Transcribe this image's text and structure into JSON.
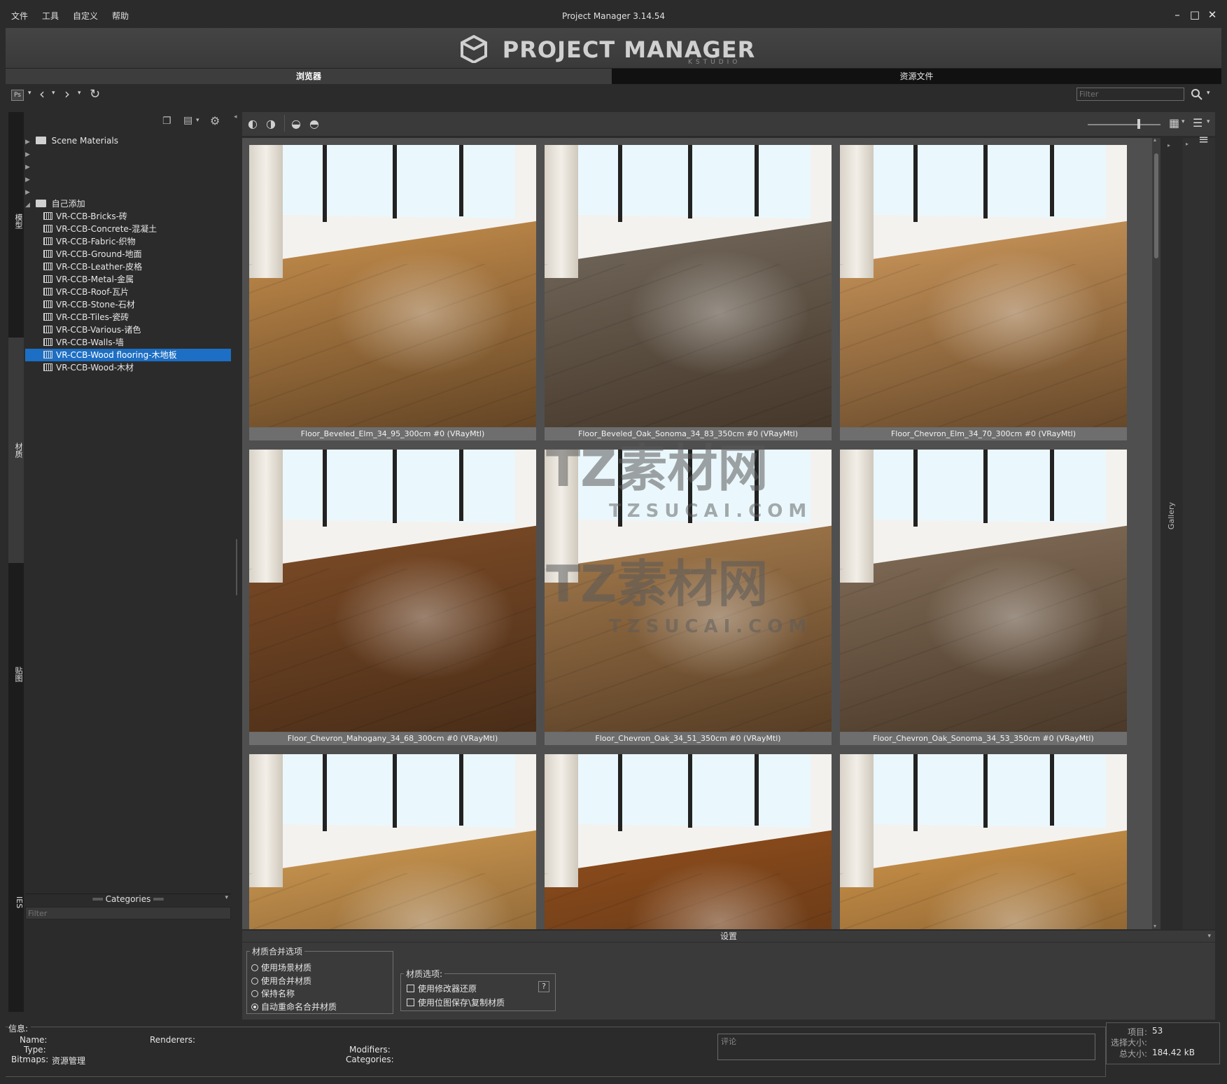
{
  "menu": [
    "文件",
    "工具",
    "自定义",
    "帮助"
  ],
  "window": {
    "title": "Project Manager 3.14.54"
  },
  "banner": {
    "logo": "PROJECT MANAGER",
    "sub": "KSTUDIO"
  },
  "tabs": {
    "browser": "浏览器",
    "assets": "资源文件"
  },
  "toolbar": {
    "filter_placeholder": "Filter"
  },
  "sidetabs": [
    "模型",
    "材质",
    "贴图",
    "IES"
  ],
  "tree": {
    "root1": "Scene Materials",
    "root2": "自己添加",
    "items": [
      "VR-CCB-Bricks-砖",
      "VR-CCB-Concrete-混凝土",
      "VR-CCB-Fabric-织物",
      "VR-CCB-Ground-地面",
      "VR-CCB-Leather-皮格",
      "VR-CCB-Metal-金属",
      "VR-CCB-Roof-瓦片",
      "VR-CCB-Stone-石材",
      "VR-CCB-Tiles-瓷砖",
      "VR-CCB-Various-诸色",
      "VR-CCB-Walls-墙",
      "VR-CCB-Wood flooring-木地板",
      "VR-CCB-Wood-木材"
    ],
    "selected_index": 11
  },
  "categories": {
    "title": "Categories",
    "filter_placeholder": "Filter"
  },
  "gallery": {
    "side_label": "Gallery",
    "thumbs": [
      {
        "label": "Floor_Beveled_Elm_34_95_300cm #0 (VRayMtl)",
        "tone": "#c08a4a"
      },
      {
        "label": "Floor_Beveled_Oak_Sonoma_34_83_350cm #0 (VRayMtl)",
        "tone": "#6f6558"
      },
      {
        "label": "Floor_Chevron_Elm_34_70_300cm #0 (VRayMtl)",
        "tone": "#c79358"
      },
      {
        "label": "Floor_Chevron_Mahogany_34_68_300cm #0 (VRayMtl)",
        "tone": "#7a4a26"
      },
      {
        "label": "Floor_Chevron_Oak_34_51_350cm #0 (VRayMtl)",
        "tone": "#a0774a"
      },
      {
        "label": "Floor_Chevron_Oak_Sonoma_34_53_350cm #0 (VRayMtl)",
        "tone": "#7e6a55"
      },
      {
        "label": "",
        "tone": "#c9954f"
      },
      {
        "label": "",
        "tone": "#8c4c1c"
      },
      {
        "label": "",
        "tone": "#c78f47"
      }
    ]
  },
  "watermark": {
    "main": "TZ素材网",
    "sub": "TZSUCAI.COM"
  },
  "settings": {
    "title": "设置",
    "merge_group": "材质合并选项",
    "merge_options": [
      "使用场景材质",
      "使用合并材质",
      "保持名称",
      "自动重命名合并材质"
    ],
    "merge_selected": 3,
    "mat_group": "材质选项:",
    "mat_options": [
      "使用修改器还原",
      "使用位图保存\\复制材质"
    ],
    "help": "?"
  },
  "info": {
    "title": "信息:",
    "name_label": "Name:",
    "type_label": "Type:",
    "bitmaps_label": "Bitmaps:",
    "bitmaps_value": "资源管理",
    "renderers_label": "Renderers:",
    "modifiers_label": "Modifiers:",
    "categories_label": "Categories:",
    "comment_placeholder": "评论",
    "items_label": "项目:",
    "items_value": "53",
    "selsize_label": "选择大小:",
    "total_label": "总大小:",
    "total_value": "184.42 kB"
  }
}
